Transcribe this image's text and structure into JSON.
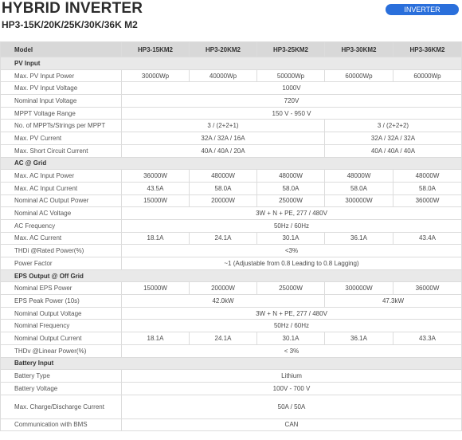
{
  "header": {
    "title": "HYBRID INVERTER",
    "subtitle": "HP3-15K/20K/25K/30K/36K M2",
    "badge": "INVERTER"
  },
  "table": {
    "model_label": "Model",
    "models": [
      "HP3-15KM2",
      "HP3-20KM2",
      "HP3-25KM2",
      "HP3-30KM2",
      "HP3-36KM2"
    ],
    "sections": [
      {
        "title": "PV Input",
        "rows": [
          {
            "label": "Max. PV Input Power",
            "cells": [
              {
                "v": "30000Wp",
                "span": 1
              },
              {
                "v": "40000Wp",
                "span": 1
              },
              {
                "v": "50000Wp",
                "span": 1
              },
              {
                "v": "60000Wp",
                "span": 1
              },
              {
                "v": "60000Wp",
                "span": 1
              }
            ]
          },
          {
            "label": "Max. PV Input Voltage",
            "cells": [
              {
                "v": "1000V",
                "span": 5
              }
            ]
          },
          {
            "label": "Nominal Input Voltage",
            "cells": [
              {
                "v": "720V",
                "span": 5
              }
            ]
          },
          {
            "label": "MPPT Voltage Range",
            "cells": [
              {
                "v": "150 V - 950 V",
                "span": 5
              }
            ]
          },
          {
            "label": "No. of MPPTs/Strings per MPPT",
            "cells": [
              {
                "v": "3 / (2+2+1)",
                "span": 3
              },
              {
                "v": "3 / (2+2+2)",
                "span": 2
              }
            ]
          },
          {
            "label": "Max. PV Current",
            "cells": [
              {
                "v": "32A / 32A / 16A",
                "span": 3
              },
              {
                "v": "32A / 32A / 32A",
                "span": 2
              }
            ]
          },
          {
            "label": "Max. Short Circuit Current",
            "cells": [
              {
                "v": "40A / 40A / 20A",
                "span": 3
              },
              {
                "v": "40A / 40A / 40A",
                "span": 2
              }
            ]
          }
        ]
      },
      {
        "title": "AC @ Grid",
        "rows": [
          {
            "label": "Max. AC Input Power",
            "cells": [
              {
                "v": "36000W",
                "span": 1
              },
              {
                "v": "48000W",
                "span": 1
              },
              {
                "v": "48000W",
                "span": 1
              },
              {
                "v": "48000W",
                "span": 1
              },
              {
                "v": "48000W",
                "span": 1
              }
            ]
          },
          {
            "label": "Max. AC Input Current",
            "cells": [
              {
                "v": "43.5A",
                "span": 1
              },
              {
                "v": "58.0A",
                "span": 1
              },
              {
                "v": "58.0A",
                "span": 1
              },
              {
                "v": "58.0A",
                "span": 1
              },
              {
                "v": "58.0A",
                "span": 1
              }
            ]
          },
          {
            "label": "Nominal AC Output Power",
            "cells": [
              {
                "v": "15000W",
                "span": 1
              },
              {
                "v": "20000W",
                "span": 1
              },
              {
                "v": "25000W",
                "span": 1
              },
              {
                "v": "300000W",
                "span": 1
              },
              {
                "v": "36000W",
                "span": 1
              }
            ]
          },
          {
            "label": "Nominal AC Voltage",
            "cells": [
              {
                "v": "3W + N + PE, 277 / 480V",
                "span": 5
              }
            ]
          },
          {
            "label": "AC Frequency",
            "cells": [
              {
                "v": "50Hz / 60Hz",
                "span": 5
              }
            ]
          },
          {
            "label": "Max. AC Current",
            "cells": [
              {
                "v": "18.1A",
                "span": 1
              },
              {
                "v": "24.1A",
                "span": 1
              },
              {
                "v": "30.1A",
                "span": 1
              },
              {
                "v": "36.1A",
                "span": 1
              },
              {
                "v": "43.4A",
                "span": 1
              }
            ]
          },
          {
            "label": "THDi @Rated Power(%)",
            "cells": [
              {
                "v": "<3%",
                "span": 5
              }
            ]
          },
          {
            "label": "Power Factor",
            "cells": [
              {
                "v": "~1 (Adjustable from 0.8 Leading to 0.8 Lagging)",
                "span": 5
              }
            ]
          }
        ]
      },
      {
        "title": "EPS Output @ Off Grid",
        "rows": [
          {
            "label": "Nominal EPS Power",
            "cells": [
              {
                "v": "15000W",
                "span": 1
              },
              {
                "v": "20000W",
                "span": 1
              },
              {
                "v": "25000W",
                "span": 1
              },
              {
                "v": "300000W",
                "span": 1
              },
              {
                "v": "36000W",
                "span": 1
              }
            ]
          },
          {
            "label": "EPS Peak Power (10s)",
            "cells": [
              {
                "v": "42.0kW",
                "span": 3
              },
              {
                "v": "47.3kW",
                "span": 2
              }
            ]
          },
          {
            "label": "Nominal Output Voltage",
            "cells": [
              {
                "v": "3W + N + PE, 277 / 480V",
                "span": 5
              }
            ]
          },
          {
            "label": "Nominal Frequency",
            "cells": [
              {
                "v": "50Hz / 60Hz",
                "span": 5
              }
            ]
          },
          {
            "label": "Nominal Output Current",
            "cells": [
              {
                "v": "18.1A",
                "span": 1
              },
              {
                "v": "24.1A",
                "span": 1
              },
              {
                "v": "30.1A",
                "span": 1
              },
              {
                "v": "36.1A",
                "span": 1
              },
              {
                "v": "43.3A",
                "span": 1
              }
            ]
          },
          {
            "label": "THDv @Linear Power(%)",
            "cells": [
              {
                "v": "< 3%",
                "span": 5
              }
            ]
          }
        ]
      },
      {
        "title": "Battery Input",
        "rows": [
          {
            "label": "Battery Type",
            "cells": [
              {
                "v": "Lithium",
                "span": 5
              }
            ]
          },
          {
            "label": "Battery Voltage",
            "cells": [
              {
                "v": "100V - 700 V",
                "span": 5
              }
            ]
          },
          {
            "label": "Max. Charge/Discharge Current",
            "tall": true,
            "cells": [
              {
                "v": "50A / 50A",
                "span": 5
              }
            ]
          },
          {
            "label": "Communication with BMS",
            "cells": [
              {
                "v": "CAN",
                "span": 5
              }
            ]
          }
        ]
      }
    ]
  }
}
